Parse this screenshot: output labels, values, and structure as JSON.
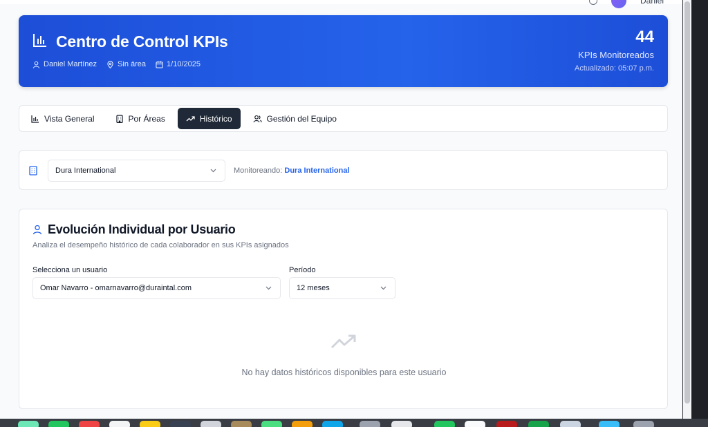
{
  "topbar": {
    "user_name": "Daniel"
  },
  "hero": {
    "title": "Centro de Control KPIs",
    "user": "Daniel Martínez",
    "area": "Sin área",
    "date": "1/10/2025",
    "count": "44",
    "count_label": "KPIs Monitoreados",
    "updated": "Actualizado: 05:07 p.m."
  },
  "tabs": [
    {
      "label": "Vista General",
      "icon": "bar-chart-icon",
      "active": false
    },
    {
      "label": "Por Áreas",
      "icon": "building-icon",
      "active": false
    },
    {
      "label": "Histórico",
      "icon": "trending-up-icon",
      "active": true
    },
    {
      "label": "Gestión del Equipo",
      "icon": "users-icon",
      "active": false
    }
  ],
  "company": {
    "selected": "Dura International",
    "monitor_prefix": "Monitoreando:",
    "monitor_value": "Dura International"
  },
  "history": {
    "title": "Evolución Individual por Usuario",
    "subtitle": "Analiza el desempeño histórico de cada colaborador en sus KPIs asignados",
    "user_label": "Selecciona un usuario",
    "user_value": "Omar Navarro - omarnavarro@duraintal.com",
    "period_label": "Período",
    "period_value": "12 meses",
    "empty_text": "No hay datos históricos disponibles para este usuario"
  },
  "colors": {
    "hero_blue": "#2563eb",
    "tab_active": "#1f2937",
    "accent_link": "#2563eb"
  }
}
